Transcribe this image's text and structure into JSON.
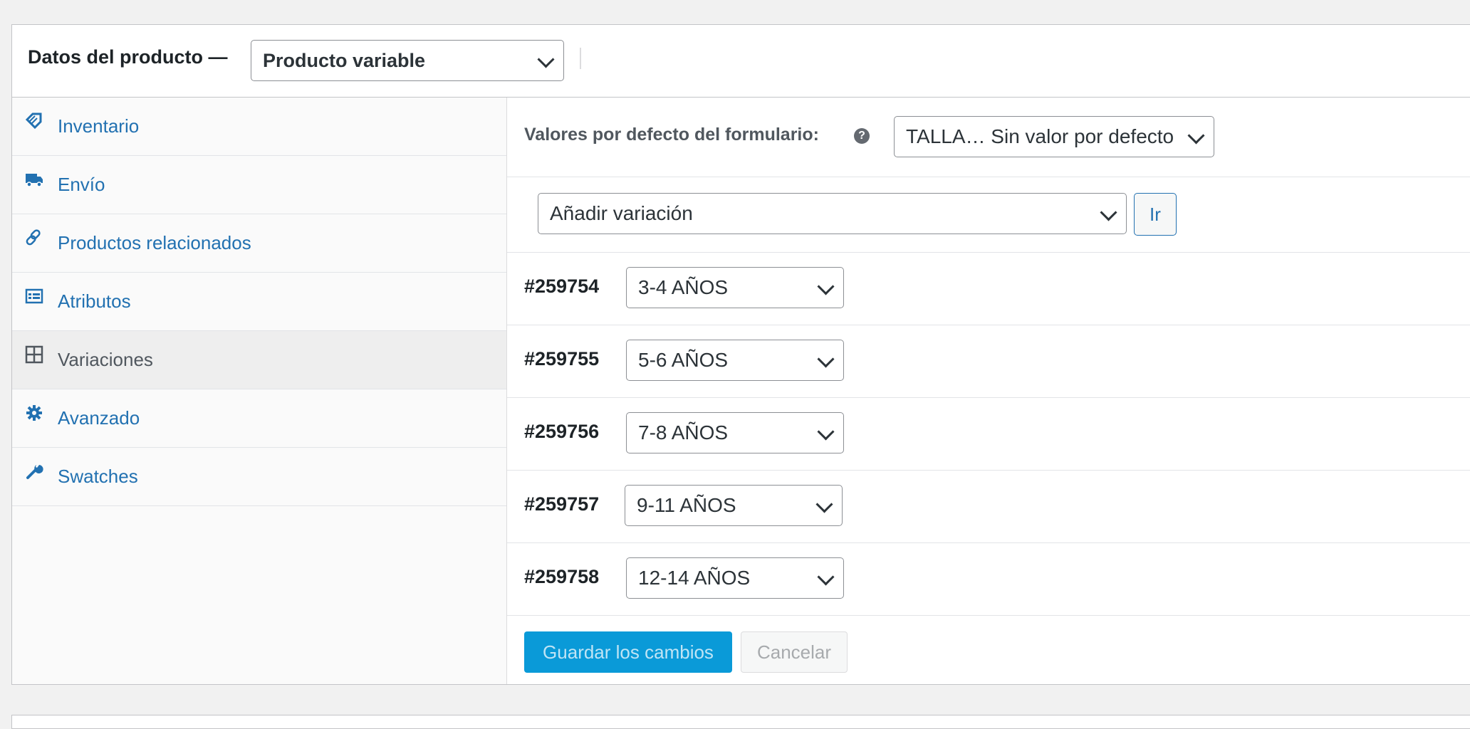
{
  "header": {
    "title": "Datos del producto —",
    "product_type_selected": "Producto variable"
  },
  "sidebar": {
    "items": [
      {
        "label": "Inventario",
        "icon": "tag-icon"
      },
      {
        "label": "Envío",
        "icon": "truck-icon"
      },
      {
        "label": "Productos relacionados",
        "icon": "link-icon"
      },
      {
        "label": "Atributos",
        "icon": "list-card-icon"
      },
      {
        "label": "Variaciones",
        "icon": "grid-icon",
        "active": true
      },
      {
        "label": "Avanzado",
        "icon": "gear-icon"
      },
      {
        "label": "Swatches",
        "icon": "wrench-icon"
      }
    ]
  },
  "main": {
    "defaults_label": "Valores por defecto del formulario:",
    "help_icon_glyph": "?",
    "defaults_select": "TALLA… Sin valor por defecto",
    "bulk_action_select": "Añadir variación",
    "go_button": "Ir",
    "variations": [
      {
        "id": "#259754",
        "value": "3-4 AÑOS"
      },
      {
        "id": "#259755",
        "value": "5-6 AÑOS"
      },
      {
        "id": "#259756",
        "value": "7-8 AÑOS"
      },
      {
        "id": "#259757",
        "value": "9-11 AÑOS"
      },
      {
        "id": "#259758",
        "value": "12-14 AÑOS"
      }
    ],
    "save_button": "Guardar los cambios",
    "cancel_button": "Cancelar"
  },
  "colors": {
    "link": "#2271b1",
    "primary_button": "#0a9ad8"
  }
}
